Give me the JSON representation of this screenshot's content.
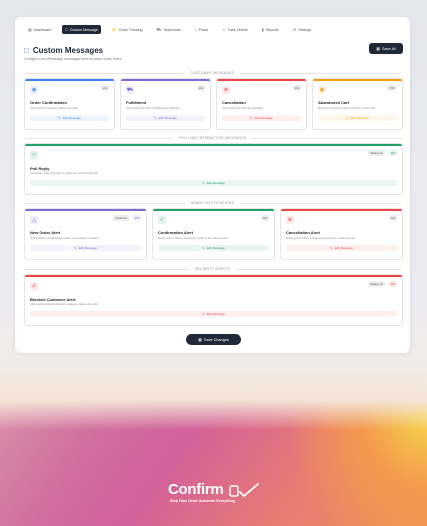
{
  "nav": {
    "items": [
      {
        "label": "Dashboard",
        "icon": "grid-icon"
      },
      {
        "label": "Custom Message",
        "icon": "message-icon",
        "active": true
      },
      {
        "label": "Order Tracking",
        "icon": "lightning-icon"
      },
      {
        "label": "Shipments",
        "icon": "truck-icon"
      },
      {
        "label": "Flows",
        "icon": "flow-icon"
      },
      {
        "label": "Fake Orders",
        "icon": "warning-icon"
      },
      {
        "label": "Reports",
        "icon": "chart-icon"
      },
      {
        "label": "Settings",
        "icon": "gear-icon"
      }
    ]
  },
  "header": {
    "title": "Custom Messages",
    "subtitle": "Configure the WhatsApp messages sent for each order event",
    "save_all": "Save All"
  },
  "sections": {
    "customer": "CUSTOMER MESSAGES",
    "poll": "POLL AND INTERACTIVE MESSAGES",
    "admin": "ADMIN NOTIFICATIONS",
    "security": "SECURITY ALERTS"
  },
  "cards": {
    "order_confirmation": {
      "title": "Order Confirmation",
      "desc": "Sent when a customer places an order",
      "badge": "EN",
      "button": "Edit Message",
      "color": "#3b82f6"
    },
    "fulfillment": {
      "title": "Fulfillment",
      "desc": "Sent when the order is fulfilled and shipped",
      "badge": "EN",
      "button": "Edit Message",
      "color": "#7c6cd6"
    },
    "cancellation": {
      "title": "Cancellation",
      "desc": "Sent when the order is cancelled",
      "badge": "EN",
      "button": "Edit Message",
      "color": "#ef4444"
    },
    "abandoned_cart": {
      "title": "Abandoned Cart",
      "desc": "Reminds customers who left items in their cart",
      "badge": "OFF",
      "button": "Edit Message",
      "color": "#f59e0b"
    },
    "poll_reply": {
      "title": "Poll Reply",
      "desc": "Automatic reply sent after a customer confirms via poll",
      "badge": "Always on",
      "badge2": "EN",
      "button": "Edit Message",
      "color": "#22a06b"
    },
    "new_order_alert": {
      "title": "New Order Alert",
      "desc": "Notify admin via WhatsApp when a new order is placed",
      "badge": "Customer",
      "badge2": "EN",
      "button": "Edit Message",
      "color": "#7c6cd6"
    },
    "confirmation_alert": {
      "title": "Confirmation Alert",
      "desc": "Notify admin when a customer confirms an order via poll",
      "badge": "EN",
      "button": "Edit Message",
      "color": "#22a06b"
    },
    "cancellation_alert": {
      "title": "Cancellation Alert",
      "desc": "Notify admin when a customer cancels an order via poll",
      "badge": "EN",
      "button": "Edit Message",
      "color": "#ef4444"
    },
    "blocked_customer": {
      "title": "Blocked Customer Alert",
      "desc": "Alerts admin when a blocked customer places an order",
      "badge": "Always on",
      "badge2": "EN",
      "button": "Edit Message",
      "color": "#ef4444"
    }
  },
  "footer": {
    "save_changes": "Save Changes"
  },
  "brand": {
    "name": "Confirm",
    "tagline": "Stop Fake Order Automate Everything"
  }
}
